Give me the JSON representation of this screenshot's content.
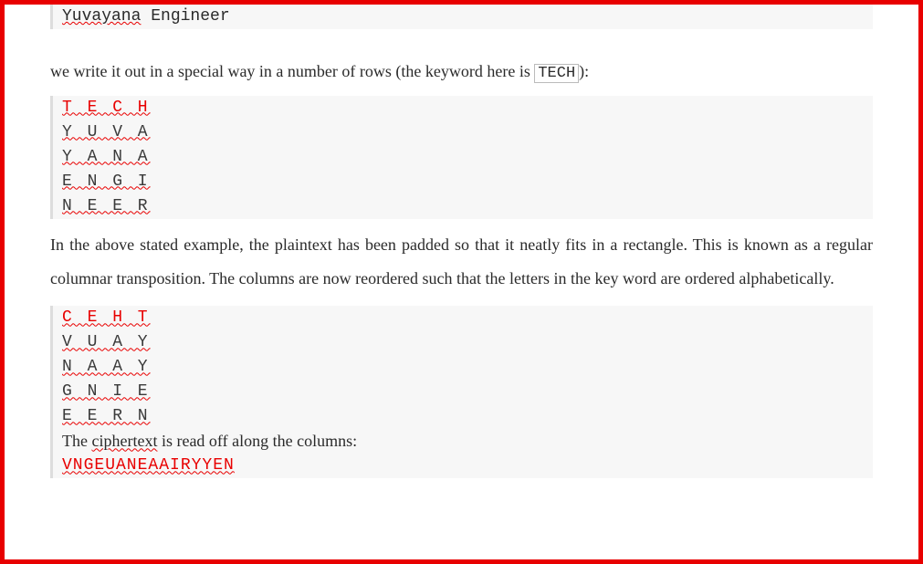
{
  "topCode": {
    "fragment_prefix_wavy": "Yuvayana",
    "fragment_suffix": " Engineer"
  },
  "intro": {
    "text_before": "we write it out in a special way in a number of rows (the keyword here is ",
    "keyword_box": "TECH",
    "text_after": "):"
  },
  "table1": {
    "rows": [
      {
        "text": "T E C H",
        "red": true
      },
      {
        "text": "Y U V A",
        "red": false
      },
      {
        "text": "Y A N A",
        "red": false
      },
      {
        "text": "E N G I",
        "red": false
      },
      {
        "text": "N E E R",
        "red": false
      }
    ]
  },
  "para1": "In the above stated example, the plaintext has been padded so that it neatly fits in a rectangle. This is known as a regular columnar transposition. The columns are now reordered such that the letters in the key word are ordered alphabetically.",
  "table2": {
    "rows": [
      {
        "text": "C E H T",
        "red": true
      },
      {
        "text": "V U A Y",
        "red": false
      },
      {
        "text": "N A A Y",
        "red": false
      },
      {
        "text": "G N I E",
        "red": false
      },
      {
        "text": "E E R N",
        "red": false
      }
    ],
    "cipher_label_before": "The ",
    "cipher_label_wavy": "ciphertext",
    "cipher_label_after": " is read off along the columns:",
    "cipher_output": "VNGEUANEAAIRYYEN"
  }
}
